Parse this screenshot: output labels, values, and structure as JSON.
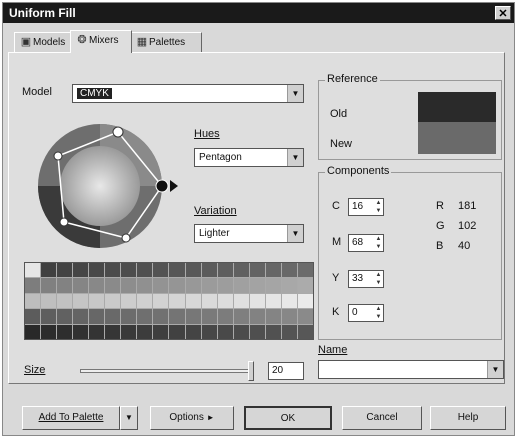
{
  "window": {
    "title": "Uniform Fill"
  },
  "tabs": [
    {
      "label": "Models",
      "icon": "models-icon"
    },
    {
      "label": "Mixers",
      "icon": "mixers-icon"
    },
    {
      "label": "Palettes",
      "icon": "palettes-icon"
    }
  ],
  "mixers": {
    "model_label": "Model",
    "model_value": "CMYK",
    "hues_label": "Hues",
    "hues_value": "Pentagon",
    "variation_label": "Variation",
    "variation_value": "Lighter",
    "size_label": "Size",
    "size_value": "20"
  },
  "reference": {
    "title": "Reference",
    "old_label": "Old",
    "new_label": "New",
    "old_color": "#2a2a2a",
    "new_color": "#6a6a6a"
  },
  "components": {
    "title": "Components",
    "c_label": "C",
    "c_value": "16",
    "m_label": "M",
    "m_value": "68",
    "y_label": "Y",
    "y_value": "33",
    "k_label": "K",
    "k_value": "0",
    "r_label": "R",
    "r_value": "181",
    "g_label": "G",
    "g_value": "102",
    "b_label": "B",
    "b_value": "40"
  },
  "name": {
    "label": "Name",
    "value": ""
  },
  "footer": {
    "add_to_palette": "Add To Palette",
    "options": "Options",
    "ok": "OK",
    "cancel": "Cancel",
    "help": "Help"
  },
  "colors": {
    "titlebar": "#1a1a1a",
    "dialog_bg": "#dedede"
  }
}
